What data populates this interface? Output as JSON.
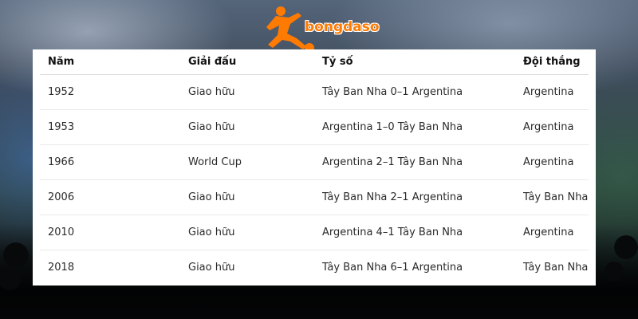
{
  "brand": {
    "logo_text": "bongdaso",
    "accent": "#ff7a00"
  },
  "table": {
    "headers": [
      "Năm",
      "Giải đấu",
      "Tỷ số",
      "Đội thắng"
    ],
    "rows": [
      [
        "1952",
        "Giao hữu",
        "Tây Ban Nha 0–1 Argentina",
        "Argentina"
      ],
      [
        "1953",
        "Giao hữu",
        "Argentina 1–0 Tây Ban Nha",
        "Argentina"
      ],
      [
        "1966",
        "World Cup",
        "Argentina 2–1 Tây Ban Nha",
        "Argentina"
      ],
      [
        "2006",
        "Giao hữu",
        "Tây Ban Nha 2–1 Argentina",
        "Tây Ban Nha"
      ],
      [
        "2010",
        "Giao hữu",
        "Argentina 4–1 Tây Ban Nha",
        "Argentina"
      ],
      [
        "2018",
        "Giao hữu",
        "Tây Ban Nha 6–1 Argentina",
        "Tây Ban Nha"
      ]
    ]
  }
}
